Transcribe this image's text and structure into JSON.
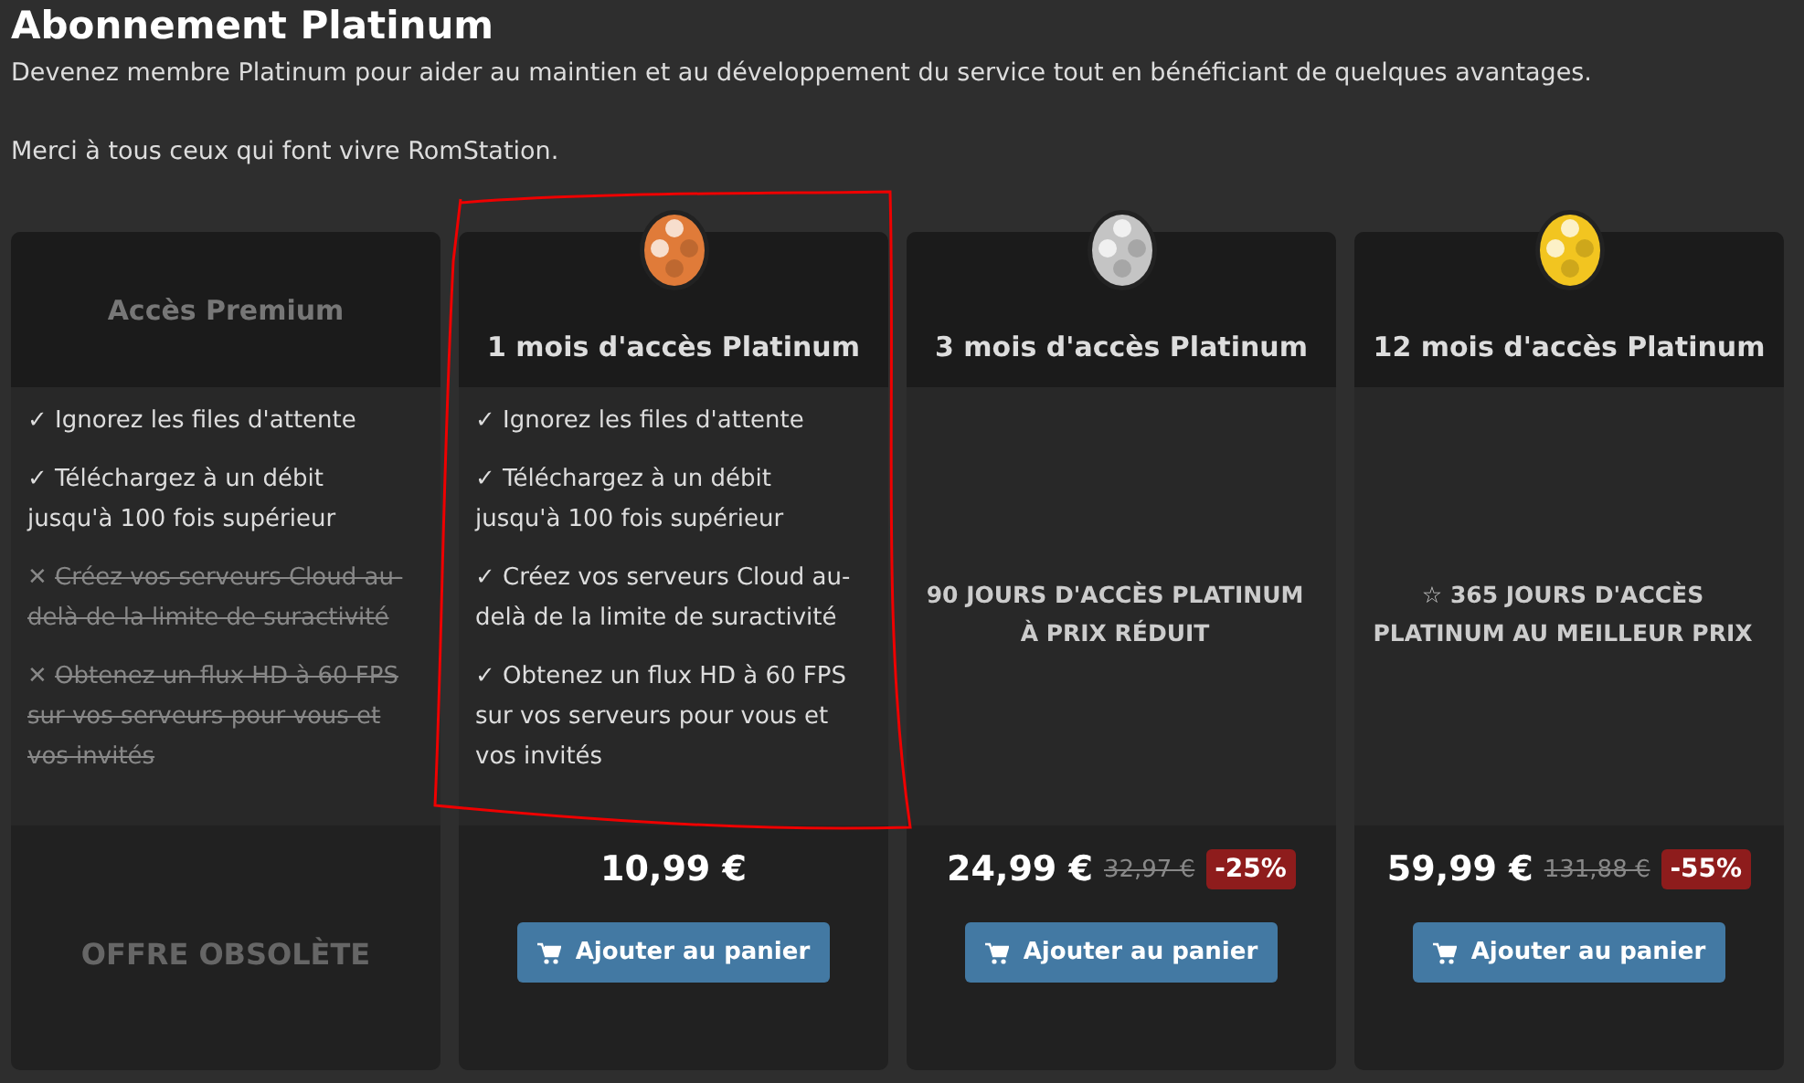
{
  "title": "Abonnement Platinum",
  "intro": [
    "Devenez membre Platinum pour aider au maintien et au développement du service tout en bénéficiant de quelques avantages.",
    "Merci à tous ceux qui font vivre RomStation."
  ],
  "plans": [
    {
      "kind": "legacy",
      "name": "Accès Premium",
      "features": [
        {
          "mark": "✓",
          "text": "Ignorez les files d'attente",
          "included": true
        },
        {
          "mark": "✓",
          "text": "Téléchargez à un débit jusqu'à 100 fois supérieur",
          "included": true
        },
        {
          "mark": "✕",
          "text": "Créez vos serveurs Cloud au-delà de la limite de suractivité",
          "included": false
        },
        {
          "mark": "✕",
          "text": "Obtenez un flux HD à 60 FPS sur vos serveurs pour vous et vos invités",
          "included": false
        }
      ],
      "status": "OFFRE OBSOLÈTE"
    },
    {
      "kind": "plan",
      "color": "#e07b39",
      "name": "1 mois d'accès Platinum",
      "features": [
        {
          "mark": "✓",
          "text": "Ignorez les files d'attente",
          "included": true
        },
        {
          "mark": "✓",
          "text": "Téléchargez à un débit jusqu'à 100 fois supérieur",
          "included": true
        },
        {
          "mark": "✓",
          "text": "Créez vos serveurs Cloud au-delà de la limite de suractivité",
          "included": true
        },
        {
          "mark": "✓",
          "text": "Obtenez un flux HD à 60 FPS sur vos serveurs pour vous et vos invités",
          "included": true
        }
      ],
      "price": "10,99 €",
      "button": "Ajouter au panier"
    },
    {
      "kind": "plan",
      "color": "#c4c4c4",
      "name": "3 mois d'accès Platinum",
      "tagline": "90 JOURS D'ACCÈS PLATINUM À PRIX RÉDUIT",
      "price": "24,99 €",
      "old_price": "32,97 €",
      "discount": "-25%",
      "button": "Ajouter au panier"
    },
    {
      "kind": "plan",
      "color": "#f2c520",
      "name": "12 mois d'accès Platinum",
      "tagline": "☆ 365 JOURS D'ACCÈS PLATINUM AU MEILLEUR PRIX",
      "price": "59,99 €",
      "old_price": "131,88 €",
      "discount": "-55%",
      "button": "Ajouter au panier"
    }
  ]
}
